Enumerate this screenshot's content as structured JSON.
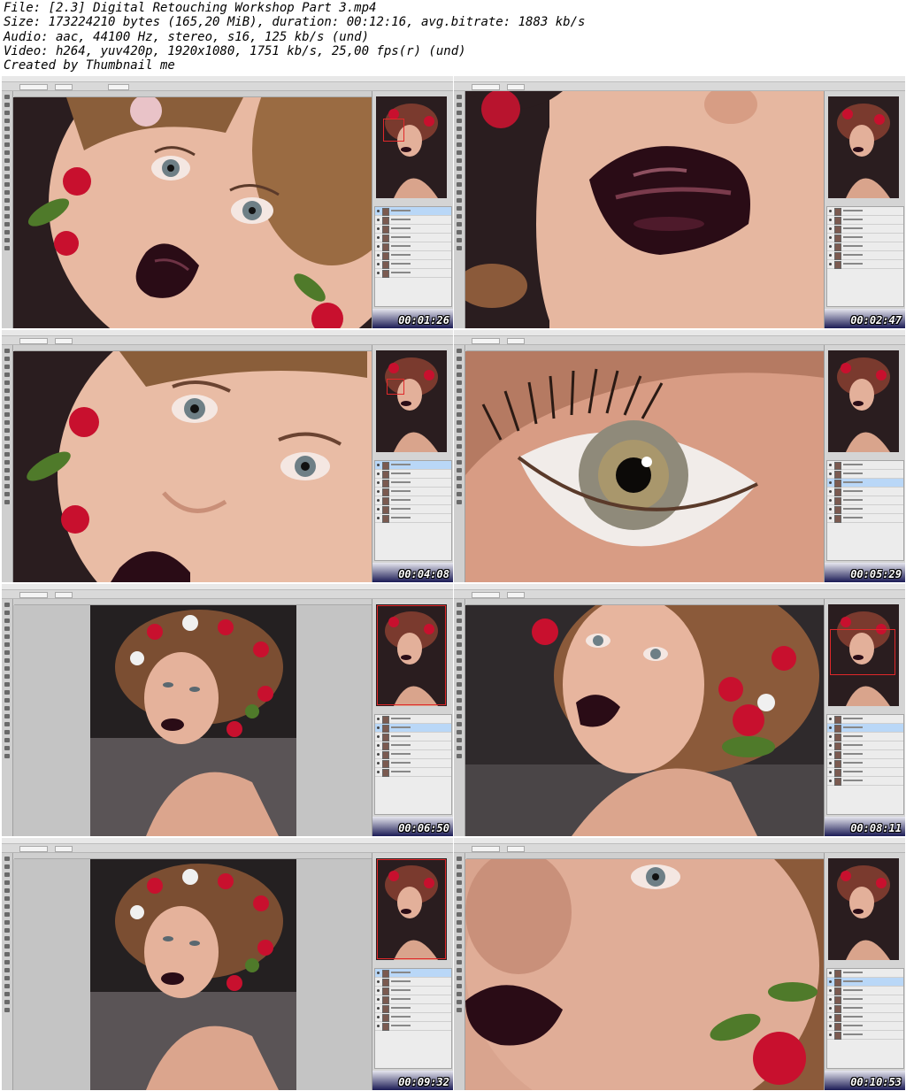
{
  "header": {
    "lines": [
      "File: [2.3] Digital Retouching Workshop Part 3.mp4",
      "Size: 173224210 bytes (165,20 MiB), duration: 00:12:16, avg.bitrate: 1883 kb/s",
      "Audio: aac, 44100 Hz, stereo, s16, 125 kb/s (und)",
      "Video: h264, yuv420p, 1920x1080, 1751 kb/s, 25,00 fps(r) (und)",
      "Created by Thumbnail me"
    ]
  },
  "thumbnails": [
    {
      "timestamp": "00:01:26",
      "scene": "face-lips-closeup"
    },
    {
      "timestamp": "00:02:47",
      "scene": "lips-macro"
    },
    {
      "timestamp": "00:04:08",
      "scene": "eyes-nose-closeup"
    },
    {
      "timestamp": "00:05:29",
      "scene": "eye-macro"
    },
    {
      "timestamp": "00:06:50",
      "scene": "full-portrait-fit"
    },
    {
      "timestamp": "00:08:11",
      "scene": "portrait-zoomed"
    },
    {
      "timestamp": "00:09:32",
      "scene": "full-portrait-fit"
    },
    {
      "timestamp": "00:10:53",
      "scene": "skin-texture-closeup"
    }
  ],
  "colors": {
    "skin": "#e8b9a2",
    "lips": "#2a0c16",
    "rose": "#c8102e",
    "leaf": "#4f7a2a",
    "hair": "#9a6b42",
    "background": "#241a1c"
  }
}
